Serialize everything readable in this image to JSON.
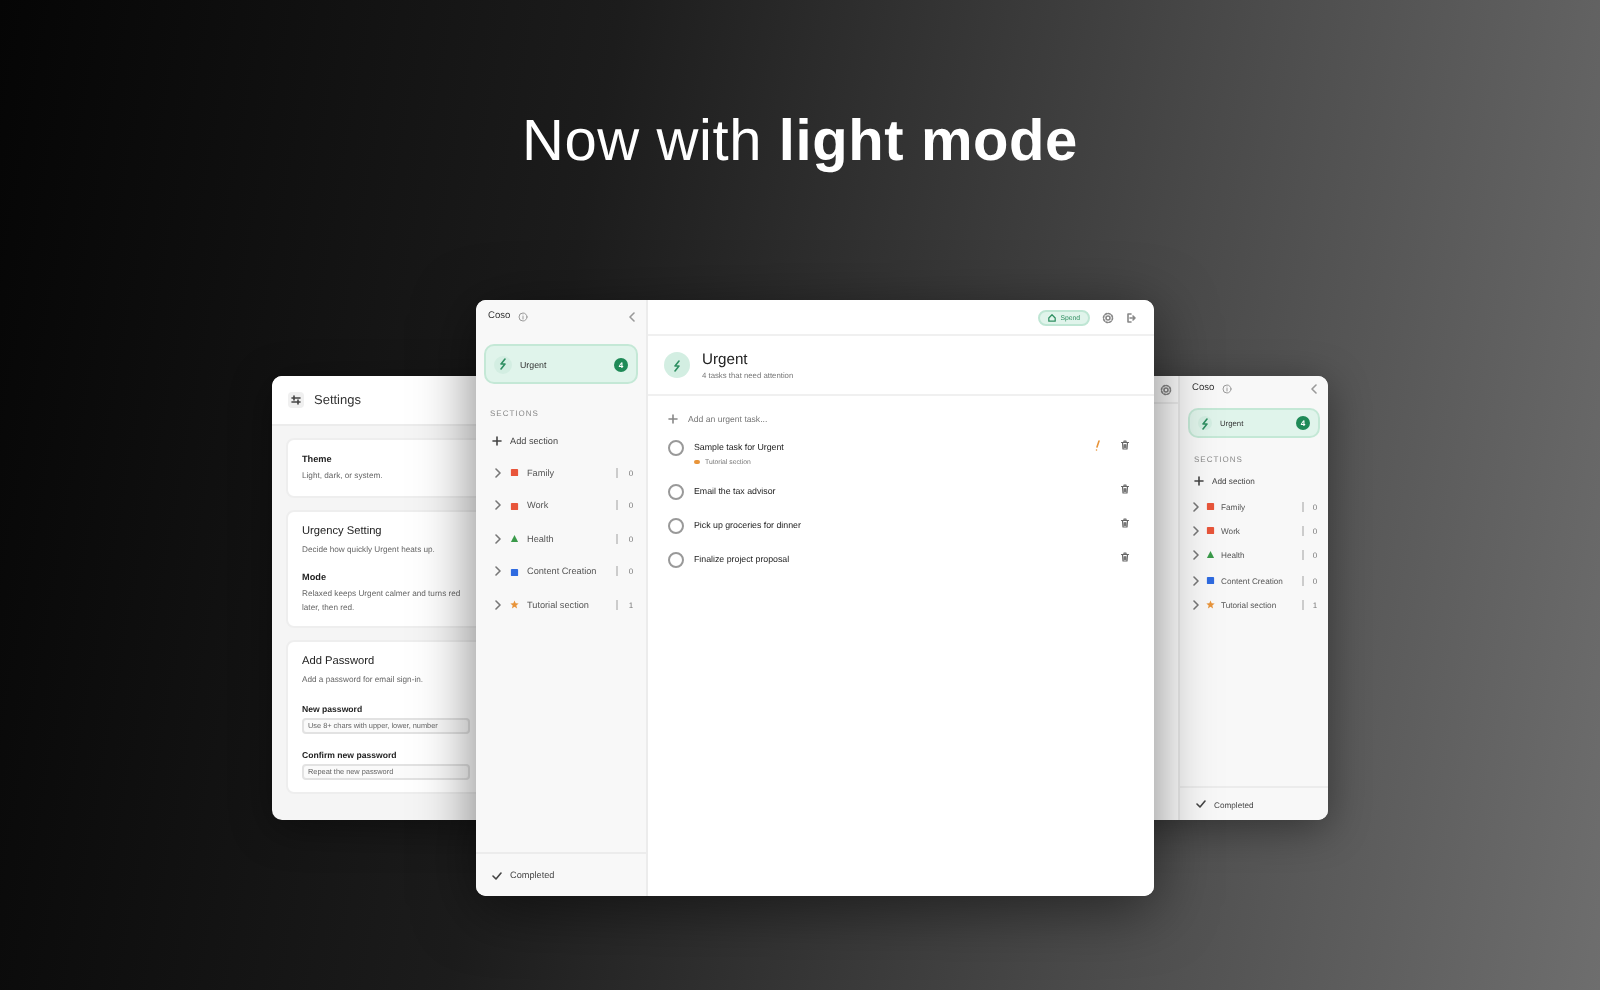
{
  "headline": "Now with **light mode**",
  "settings_window": {
    "title": "Settings",
    "cards": [
      {
        "items": [
          {
            "kind": "option",
            "title": "Theme",
            "description": "Light, dark, or system."
          }
        ]
      },
      {
        "items": [
          {
            "kind": "heading",
            "title": "Urgency Setting",
            "description": "Decide how quickly Urgent heats up."
          },
          {
            "kind": "option",
            "title": "Mode",
            "description": "Relaxed keeps Urgent calmer and turns red later, then red."
          }
        ]
      },
      {
        "items": [
          {
            "kind": "heading",
            "title": "Add Password",
            "description": "Add a password for email sign-in."
          },
          {
            "kind": "field",
            "label": "New password",
            "placeholder": "Use 8+ chars with upper, lower, number"
          },
          {
            "kind": "field",
            "label": "Confirm new password",
            "placeholder": "Repeat the new password"
          }
        ]
      }
    ]
  },
  "mirror_window": {
    "sidebar": {
      "app_name": "Coso",
      "urgent": {
        "label": "Urgent",
        "count": "4",
        "selected": true
      },
      "sections_label": "SECTIONS",
      "add_section": "Add section",
      "sections": [
        {
          "name": "Family",
          "count": "0",
          "color": "#e8553a",
          "kind": "square"
        },
        {
          "name": "Work",
          "count": "0",
          "color": "#e8553a",
          "kind": "square"
        },
        {
          "name": "Health",
          "count": "0",
          "color": "#3a9a4a",
          "kind": "triangle"
        },
        {
          "name": "Content Creation",
          "count": "0",
          "color": "#2f6be0",
          "kind": "square"
        },
        {
          "name": "Tutorial section",
          "count": "1",
          "color": "#e8943a",
          "kind": "star"
        }
      ],
      "completed": {
        "label": "Completed",
        "selected": false
      }
    }
  },
  "app": {
    "sidebar": {
      "app_name": "Coso",
      "urgent": {
        "label": "Urgent",
        "count": "4",
        "selected": true
      },
      "sections_label": "SECTIONS",
      "add_section": "Add section",
      "sections": [
        {
          "name": "Family",
          "count": "0",
          "color": "#e8553a",
          "kind": "square"
        },
        {
          "name": "Work",
          "count": "0",
          "color": "#e8553a",
          "kind": "square"
        },
        {
          "name": "Health",
          "count": "0",
          "color": "#3a9a4a",
          "kind": "triangle"
        },
        {
          "name": "Content Creation",
          "count": "0",
          "color": "#2f6be0",
          "kind": "square"
        },
        {
          "name": "Tutorial section",
          "count": "1",
          "color": "#e8943a",
          "kind": "star"
        }
      ],
      "completed": {
        "label": "Completed",
        "selected": false
      }
    },
    "main": {
      "spend_button": "Spend",
      "title": "Urgent",
      "subtitle": "4 tasks that need attention",
      "add_placeholder": "Add an urgent task...",
      "tasks": [
        {
          "title": "Sample task for Urgent",
          "done": false,
          "flagged": true,
          "section": {
            "name": "Tutorial section",
            "color": "#e8943a"
          }
        },
        {
          "title": "Email the tax advisor",
          "done": false,
          "flagged": false
        },
        {
          "title": "Pick up groceries for dinner",
          "done": false,
          "flagged": false
        },
        {
          "title": "Finalize project proposal",
          "done": false,
          "flagged": false
        }
      ]
    }
  }
}
